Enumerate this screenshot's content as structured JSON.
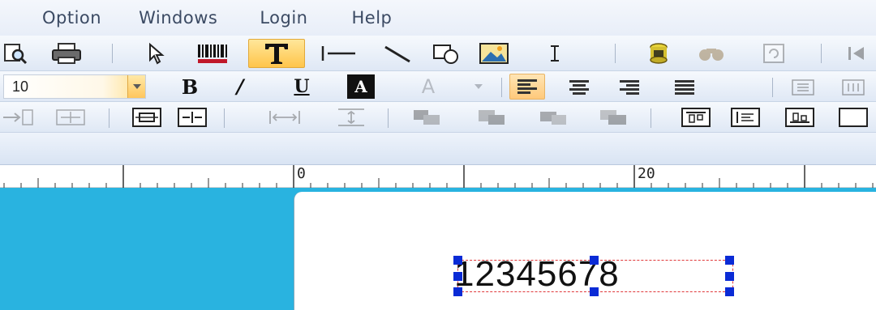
{
  "menu": {
    "option": "Option",
    "windows": "Windows",
    "login": "Login",
    "help": "Help"
  },
  "toolbar": {
    "row1_icons": [
      "print-preview-icon",
      "print-icon",
      "pointer-icon",
      "barcode-icon",
      "text-tool-icon",
      "horizontal-line-icon",
      "diagonal-line-icon",
      "shape-tool-icon",
      "image-tool-icon",
      "text-cursor-icon",
      "database-icon",
      "find-icon",
      "rotate-icon",
      "first-page-icon"
    ],
    "active_tool": "text-tool-icon",
    "font_size": "10",
    "bold_label": "B",
    "italic_label": "/",
    "underline_label": "U",
    "inverse_label": "A",
    "font_color_label": "A",
    "active_alignment": "align-left-icon",
    "accent_color": "#ffc54a"
  },
  "ruler": {
    "label_0": "0",
    "label_20": "20"
  },
  "canvas": {
    "background_color": "#29b3e0",
    "barcode_text": "12345678",
    "selection_color": "#e0383a",
    "handle_color": "#0a2bd6"
  }
}
